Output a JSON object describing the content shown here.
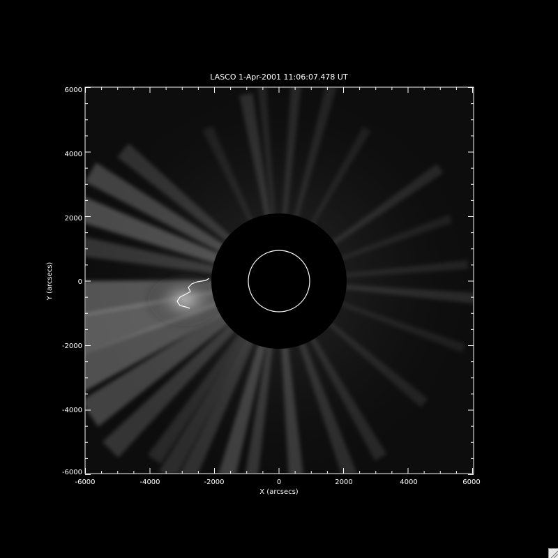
{
  "image": {
    "title": "LASCO  1-Apr-2001 11:06:07.478 UT",
    "x_axis_label": "X (arcsecs)",
    "y_axis_label": "Y (arcsecs)",
    "x_range": [
      -6000,
      6000
    ],
    "y_range": [
      -6000,
      6000
    ],
    "x_tick_labels": [
      "-6000",
      "-4000",
      "-2000",
      "0",
      "2000",
      "4000",
      "6000"
    ],
    "y_tick_labels": [
      "6000",
      "4000",
      "2000",
      "0",
      "-2000",
      "-4000",
      "-6000"
    ],
    "occulter_radius_arcsec": 2100,
    "solar_limb_radius_arcsec": 960,
    "colors": {
      "background": "#000000",
      "axis": "#ffffff",
      "limb_circle": "#ffffff",
      "corona_glow": "#cfcfcf"
    }
  },
  "window": {
    "resize_grip_icon": "resize-grip-icon"
  }
}
